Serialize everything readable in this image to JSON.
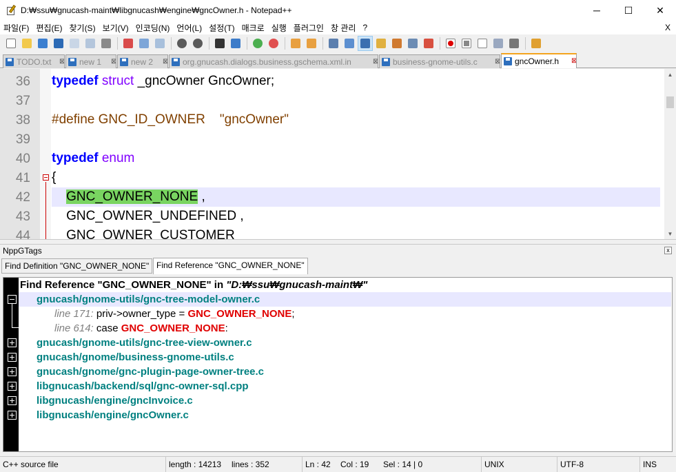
{
  "window": {
    "title": "D:₩ssu₩gnucash-maint₩libgnucash₩engine₩gncOwner.h - Notepad++",
    "minimize": "─",
    "maximize": "☐",
    "close": "✕"
  },
  "menu": {
    "items": [
      "파일(F)",
      "편집(E)",
      "찾기(S)",
      "보기(V)",
      "인코딩(N)",
      "언어(L)",
      "설정(T)",
      "매크로",
      "실행",
      "플러그인",
      "창 관리",
      "?"
    ],
    "close": "X"
  },
  "toolbar": {
    "icons": [
      "new-file-icon",
      "open-file-icon",
      "save-icon",
      "save-all-icon",
      "close-icon",
      "close-all-icon",
      "print-icon",
      "cut-icon",
      "copy-icon",
      "paste-icon",
      "undo-icon",
      "redo-icon",
      "find-icon",
      "replace-icon",
      "zoom-in-icon",
      "zoom-out-icon",
      "sync-v-icon",
      "sync-h-icon",
      "word-wrap-icon",
      "show-all-chars-icon",
      "indent-guide-icon",
      "user-lang-icon",
      "doc-map-icon",
      "function-list-icon",
      "folder-workspace-icon",
      "record-macro-icon",
      "stop-macro-icon",
      "play-macro-icon",
      "run-macro-multiple-icon",
      "save-macro-icon",
      "plugin-icon"
    ]
  },
  "tabs": [
    {
      "label": "TODO.txt",
      "dirty": false
    },
    {
      "label": "new 1",
      "dirty": false
    },
    {
      "label": "new 2",
      "dirty": false
    },
    {
      "label": "org.gnucash.dialogs.business.gschema.xml.in",
      "dirty": false
    },
    {
      "label": "business-gnome-utils.c",
      "dirty": false
    },
    {
      "label": "gncOwner.h",
      "dirty": false,
      "active": true
    }
  ],
  "editor": {
    "lines": [
      {
        "n": "36",
        "parts": [
          [
            "kw",
            "typedef"
          ],
          [
            "t",
            " "
          ],
          [
            "kw2",
            "struct"
          ],
          [
            "t",
            " _gncOwner GncOwner;"
          ]
        ]
      },
      {
        "n": "37",
        "parts": []
      },
      {
        "n": "38",
        "parts": [
          [
            "pre",
            "#define GNC_ID_OWNER    \"gncOwner\""
          ]
        ]
      },
      {
        "n": "39",
        "parts": []
      },
      {
        "n": "40",
        "parts": [
          [
            "kw",
            "typedef"
          ],
          [
            "t",
            " "
          ],
          [
            "kw2",
            "enum"
          ]
        ]
      },
      {
        "n": "41",
        "parts": [
          [
            "t",
            "{"
          ]
        ]
      },
      {
        "n": "42",
        "parts": [
          [
            "t",
            "    "
          ],
          [
            "sel",
            "GNC_OWNER_NONE"
          ],
          [
            "t",
            " ,"
          ]
        ]
      },
      {
        "n": "43",
        "parts": [
          [
            "t",
            "    GNC_OWNER_UNDEFINED ,"
          ]
        ]
      },
      {
        "n": "44",
        "parts": [
          [
            "t",
            "    GNC_OWNER_CUSTOMER"
          ]
        ]
      }
    ]
  },
  "panel": {
    "title": "NppGTags",
    "close": "x",
    "tabs": [
      "Find Definition \"GNC_OWNER_NONE\"",
      "Find Reference \"GNC_OWNER_NONE\""
    ],
    "root_label": "Find Reference \"GNC_OWNER_NONE\" in ",
    "root_path": "\"D:₩ssu₩gnucash-maint₩\"",
    "expanded_file": "gnucash/gnome-utils/gnc-tree-model-owner.c",
    "results": [
      {
        "lineno": "line 171:",
        "pre": " priv->owner_type = ",
        "tag": "GNC_OWNER_NONE",
        "post": ";"
      },
      {
        "lineno": "line 614:",
        "pre": " case ",
        "tag": "GNC_OWNER_NONE",
        "post": ":"
      }
    ],
    "files": [
      "gnucash/gnome-utils/gnc-tree-view-owner.c",
      "gnucash/gnome/business-gnome-utils.c",
      "gnucash/gnome/gnc-plugin-page-owner-tree.c",
      "libgnucash/backend/sql/gnc-owner-sql.cpp",
      "libgnucash/engine/gncInvoice.c",
      "libgnucash/engine/gncOwner.c"
    ]
  },
  "status": {
    "filetype": "C++ source file",
    "length": "length : 14213",
    "lines": "lines : 352",
    "ln": "Ln : 42",
    "col": "Col : 19",
    "sel": "Sel : 14 | 0",
    "eol": "UNIX",
    "encoding": "UTF-8",
    "mode": "INS"
  }
}
